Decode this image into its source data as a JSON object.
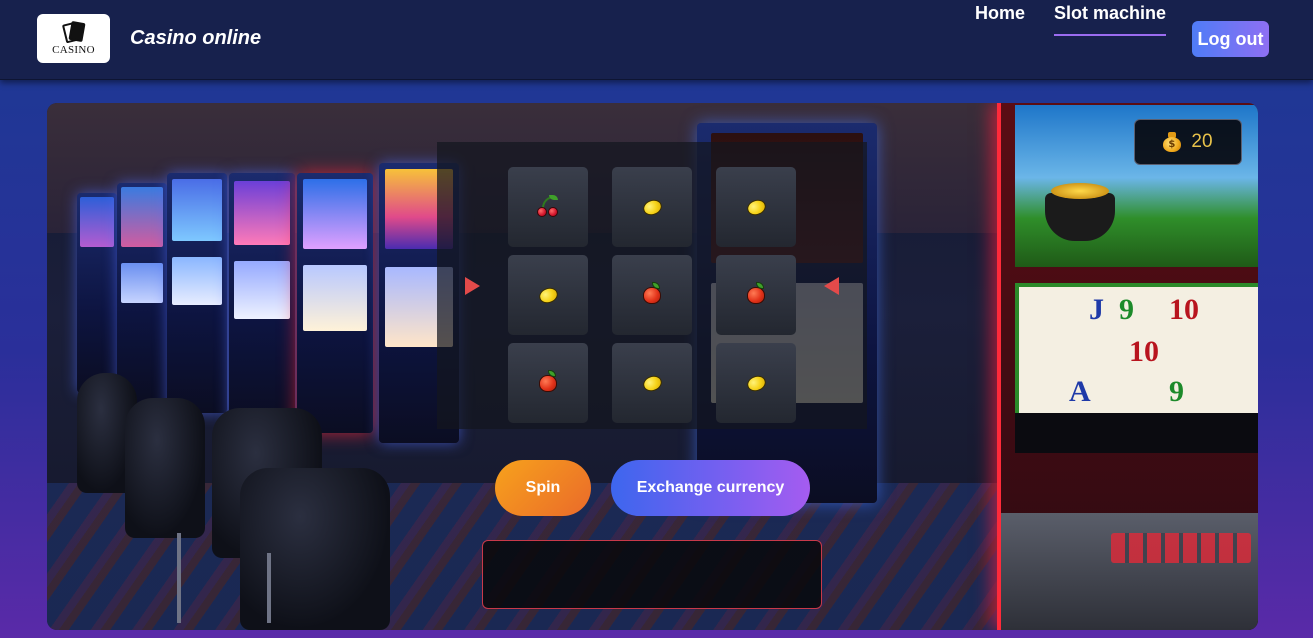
{
  "header": {
    "logo_text": "CASINO",
    "brand": "Casino online",
    "nav": [
      {
        "label": "Home",
        "active": false
      },
      {
        "label": "Slot machine",
        "active": true
      }
    ],
    "logout_label": "Log out"
  },
  "balance": {
    "icon": "money-bag-icon",
    "value": "20"
  },
  "slot": {
    "grid": [
      [
        "cherry",
        "lemon",
        "lemon"
      ],
      [
        "lemon",
        "apple",
        "apple"
      ],
      [
        "apple",
        "lemon",
        "lemon"
      ]
    ],
    "payline_marker_color": "#e34a4a"
  },
  "controls": {
    "spin_label": "Spin",
    "exchange_label": "Exchange currency"
  },
  "message": {
    "text": ""
  },
  "colors": {
    "header_bg": "#17214d",
    "spin_gradient": [
      "#f7a21c",
      "#ea6a2a"
    ],
    "exchange_gradient": [
      "#3d66ee",
      "#a55cf0"
    ],
    "message_border": "#c8394a",
    "balance_text": "#e8c24a"
  }
}
